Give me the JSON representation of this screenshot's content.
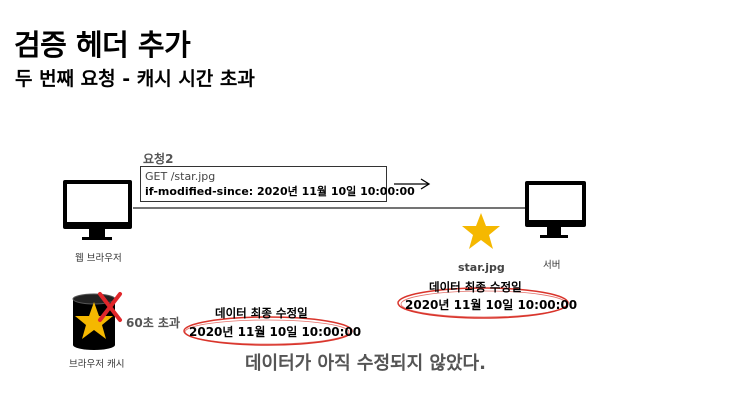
{
  "title": "검증 헤더 추가",
  "subtitle": "두 번째 요청 - 캐시 시간 초과",
  "request": {
    "label": "요청2",
    "line1": "GET /star.jpg",
    "line2": "if-modified-since: 2020년 11월 10일 10:00:00"
  },
  "client": {
    "label": "웹 브라우저",
    "icon": "monitor-icon"
  },
  "server": {
    "label": "서버",
    "icon": "monitor-icon",
    "resource_label": "star.jpg",
    "modified_caption": "데이터 최종 수정일",
    "modified_date": "2020년 11월 10일 10:00:00"
  },
  "cache": {
    "label": "브라우저 캐시",
    "icon": "database-icon",
    "timeout_label": "60초 초과",
    "modified_caption": "데이터 최종 수정일",
    "modified_date": "2020년 11월 10일 10:00:00"
  },
  "conclusion": "데이터가 아직 수정되지 않았다.",
  "colors": {
    "star": "#f5b800",
    "ellipse": "#d9342b",
    "expired_x": "#e0262a",
    "monitor": "#000000"
  }
}
